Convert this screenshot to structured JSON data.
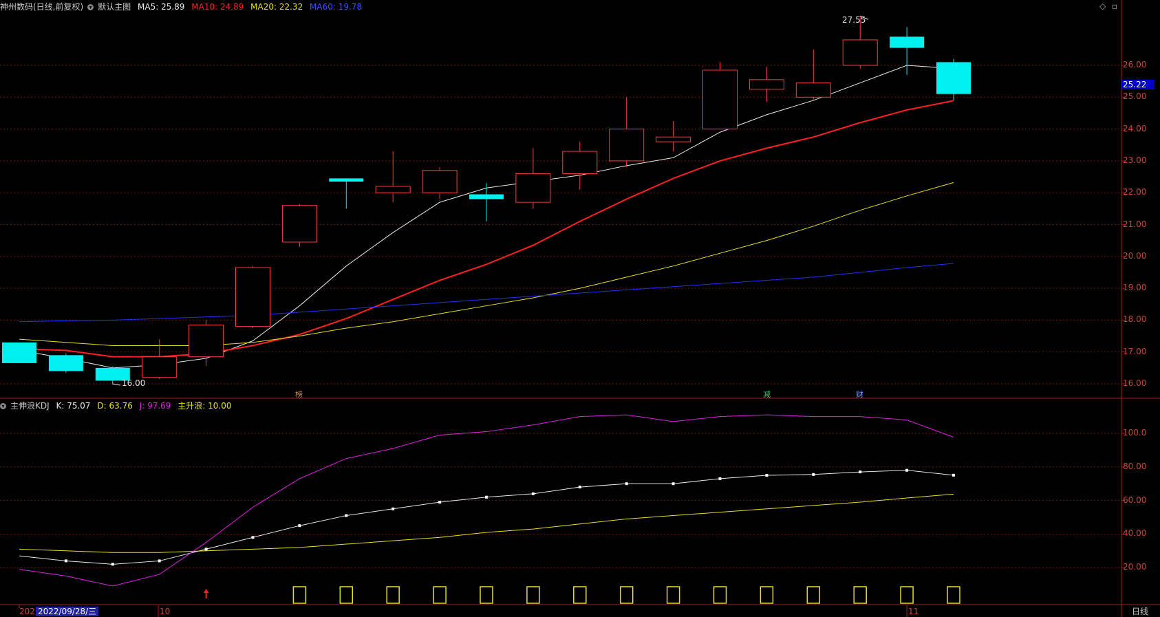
{
  "header": {
    "symbol": "神州数码(日线,前复权)",
    "indicator": "默认主图",
    "ma5_label": "MA5: 25.89",
    "ma10_label": "MA10: 24.89",
    "ma20_label": "MA20: 22.32",
    "ma60_label": "MA60: 19.78"
  },
  "sub_header": {
    "indicator": "主伸浪KDJ",
    "k_label": "K: 75.07",
    "d_label": "D: 63.76",
    "j_label": "J: 97.69",
    "zsl_label": "主升浪: 10.00"
  },
  "price_axis": [
    "26.00",
    "25.00",
    "24.00",
    "23.00",
    "22.00",
    "21.00",
    "20.00",
    "19.00",
    "18.00",
    "17.00",
    "16.00"
  ],
  "price_tag": "25.22",
  "kdj_axis": [
    "100.0",
    "80.00",
    "60.00",
    "40.00",
    "20.00"
  ],
  "annotations": {
    "high": "27.55",
    "low": "16.00"
  },
  "markers": [
    {
      "text": "榜",
      "color": "#e08030"
    },
    {
      "text": "减",
      "color": "#2fd06a"
    },
    {
      "text": "财",
      "color": "#6fa0ff"
    }
  ],
  "date_bar": {
    "prefix": "2022",
    "cursor_date": "2022/09/28/三",
    "month_oct": "10",
    "month_nov": "11",
    "period": "日线"
  },
  "icons": {
    "diamond": "diamond-icon",
    "window": "window-icon",
    "arrow": "up-arrow-icon"
  },
  "colors": {
    "up": "#ff3b3b",
    "down": "#00f0f0",
    "ma5": "#e8e8e8",
    "ma10": "#ff2020",
    "ma20": "#e8e020",
    "ma60": "#2030ff",
    "k": "#e8e8e8",
    "d": "#e8e020",
    "j": "#e020e0"
  },
  "chart_data": [
    {
      "type": "candlestick",
      "title": "神州数码(日线,前复权)",
      "ylim": [
        15.6,
        28.6
      ],
      "ohlc": [
        [
          17.3,
          17.25,
          16.65,
          16.65
        ],
        [
          16.9,
          16.95,
          16.35,
          16.4
        ],
        [
          16.5,
          16.55,
          16.0,
          16.1
        ],
        [
          16.2,
          17.4,
          16.15,
          16.85
        ],
        [
          16.85,
          18.0,
          16.55,
          17.85
        ],
        [
          17.8,
          19.7,
          17.75,
          19.65
        ],
        [
          20.45,
          21.65,
          20.3,
          21.6
        ],
        [
          22.45,
          22.45,
          21.5,
          22.35
        ],
        [
          22.0,
          23.3,
          21.7,
          22.2
        ],
        [
          22.0,
          22.8,
          21.8,
          22.7
        ],
        [
          21.95,
          22.3,
          21.1,
          21.8
        ],
        [
          21.7,
          23.4,
          21.5,
          22.6
        ],
        [
          22.6,
          23.6,
          22.1,
          23.3
        ],
        [
          23.0,
          25.0,
          22.8,
          24.0
        ],
        [
          23.6,
          24.25,
          23.3,
          23.75
        ],
        [
          24.0,
          26.1,
          24.0,
          25.85
        ],
        [
          25.25,
          25.95,
          24.85,
          25.55
        ],
        [
          25.0,
          26.5,
          24.9,
          25.45
        ],
        [
          26.0,
          27.55,
          25.9,
          26.8
        ],
        [
          26.9,
          27.2,
          25.7,
          26.55
        ],
        [
          26.1,
          26.2,
          24.9,
          25.1
        ]
      ],
      "series": [
        {
          "name": "MA5",
          "values": [
            17.05,
            16.8,
            16.5,
            16.6,
            16.8,
            17.35,
            18.45,
            19.7,
            20.75,
            21.7,
            22.15,
            22.35,
            22.55,
            22.85,
            23.1,
            23.9,
            24.45,
            24.9,
            25.45,
            26.0,
            25.9
          ]
        },
        {
          "name": "MA10",
          "values": [
            17.1,
            17.05,
            16.85,
            16.85,
            16.95,
            17.2,
            17.55,
            18.05,
            18.65,
            19.25,
            19.75,
            20.35,
            21.1,
            21.8,
            22.45,
            23.0,
            23.4,
            23.75,
            24.2,
            24.6,
            24.89
          ]
        },
        {
          "name": "MA20",
          "values": [
            17.4,
            17.3,
            17.2,
            17.2,
            17.2,
            17.3,
            17.5,
            17.75,
            17.95,
            18.2,
            18.45,
            18.7,
            19.0,
            19.35,
            19.7,
            20.1,
            20.5,
            20.95,
            21.45,
            21.9,
            22.32
          ]
        },
        {
          "name": "MA60",
          "values": [
            17.95,
            17.98,
            18.0,
            18.05,
            18.1,
            18.15,
            18.25,
            18.35,
            18.45,
            18.55,
            18.65,
            18.75,
            18.85,
            18.95,
            19.05,
            19.15,
            19.25,
            19.35,
            19.5,
            19.65,
            19.78
          ]
        }
      ]
    },
    {
      "type": "line",
      "title": "主伸浪KDJ",
      "ylim": [
        0,
        118
      ],
      "series": [
        {
          "name": "K",
          "values": [
            27,
            24,
            22,
            24,
            31,
            38,
            45,
            51,
            55,
            59,
            62,
            64,
            68,
            70,
            70,
            73,
            75,
            75.5,
            77,
            78,
            75.07
          ]
        },
        {
          "name": "D",
          "values": [
            31,
            30,
            29,
            29,
            30,
            31,
            32,
            34,
            36,
            38,
            41,
            43,
            46,
            49,
            51,
            53,
            55,
            57,
            59,
            61.5,
            63.76
          ]
        },
        {
          "name": "J",
          "values": [
            19,
            15,
            9,
            16,
            35,
            56,
            73,
            85,
            91,
            99,
            101,
            105,
            110,
            111,
            107,
            110,
            111,
            110,
            110,
            108,
            97.69
          ]
        },
        {
          "name": "主升浪",
          "values": [
            10,
            10,
            10,
            10,
            10,
            10,
            10,
            10,
            10,
            10,
            10,
            10,
            10,
            10,
            10,
            10,
            10,
            10,
            10,
            10,
            10
          ]
        }
      ]
    }
  ]
}
